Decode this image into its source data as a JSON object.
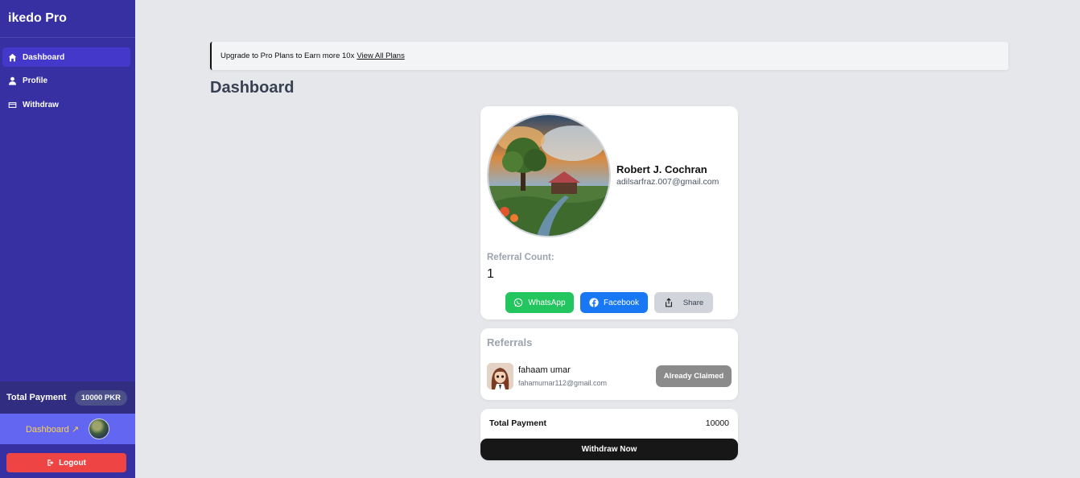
{
  "app": {
    "brand": "ikedo Pro"
  },
  "sidebar": {
    "items": [
      {
        "label": "Dashboard",
        "icon": "home-icon",
        "active": true
      },
      {
        "label": "Profile",
        "icon": "user-icon",
        "active": false
      },
      {
        "label": "Withdraw",
        "icon": "card-icon",
        "active": false
      }
    ],
    "total_payment_label": "Total Payment",
    "total_payment_value": "10000 PKR",
    "dashboard_link_label": "Dashboard",
    "dashboard_link_icon": "↗",
    "logout_label": "Logout"
  },
  "banner": {
    "text": "Upgrade to Pro Plans to Earn more 10x",
    "link_label": "View All Plans"
  },
  "main": {
    "title": "Dashboard"
  },
  "profile": {
    "name": "Robert J. Cochran",
    "email": "adilsarfraz.007@gmail.com",
    "referral_count_label": "Referral Count:",
    "referral_count": "1",
    "share_buttons": [
      {
        "label": "WhatsApp",
        "icon": "whatsapp-icon",
        "color": "#22c55e"
      },
      {
        "label": "Facebook",
        "icon": "facebook-icon",
        "color": "#1877f2"
      },
      {
        "label": "Share",
        "icon": "share-icon",
        "color": "#d1d5db"
      }
    ]
  },
  "referrals": {
    "title": "Referrals",
    "items": [
      {
        "name": "fahaam umar",
        "email": "fahamumar112@gmail.com",
        "status": "Already Claimed"
      }
    ]
  },
  "payment": {
    "label": "Total Payment",
    "value": "10000",
    "withdraw_label": "Withdraw Now"
  },
  "colors": {
    "sidebar_bg": "#3730a3",
    "accent": "#6366f1",
    "logout": "#ef4444",
    "page_bg": "#e5e7eb"
  }
}
